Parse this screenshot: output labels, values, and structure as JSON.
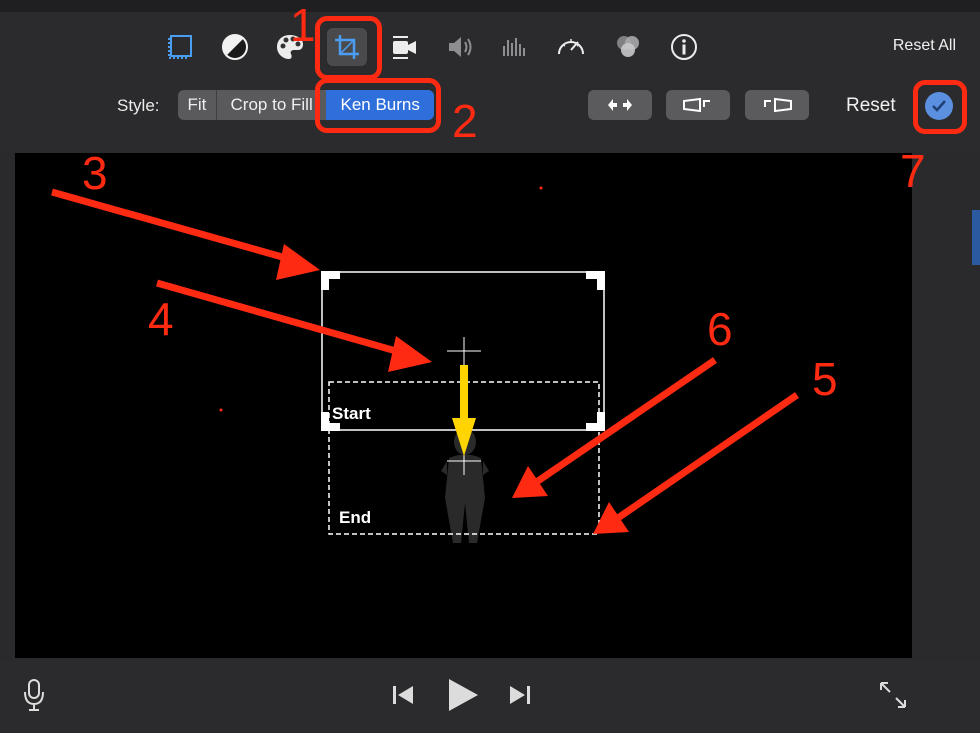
{
  "toolbar": {
    "tools": [
      {
        "name": "color-balance-icon"
      },
      {
        "name": "color-correction-icon"
      },
      {
        "name": "palette-icon"
      },
      {
        "name": "crop-icon"
      },
      {
        "name": "stabilization-icon"
      },
      {
        "name": "volume-icon"
      },
      {
        "name": "equalizer-icon"
      },
      {
        "name": "speed-icon"
      },
      {
        "name": "filter-icon"
      },
      {
        "name": "info-icon"
      }
    ],
    "reset_all": "Reset All"
  },
  "style_bar": {
    "label": "Style:",
    "options": [
      "Fit",
      "Crop to Fill",
      "Ken Burns"
    ],
    "selected": "Ken Burns",
    "reset": "Reset"
  },
  "viewer": {
    "start_label": "Start",
    "end_label": "End"
  },
  "annotations": [
    "1",
    "2",
    "3",
    "4",
    "5",
    "6",
    "7"
  ],
  "colors": {
    "accent_blue": "#2f6fdb",
    "annotation_red": "#ff2a12",
    "arrow_yellow": "#ffd400"
  }
}
